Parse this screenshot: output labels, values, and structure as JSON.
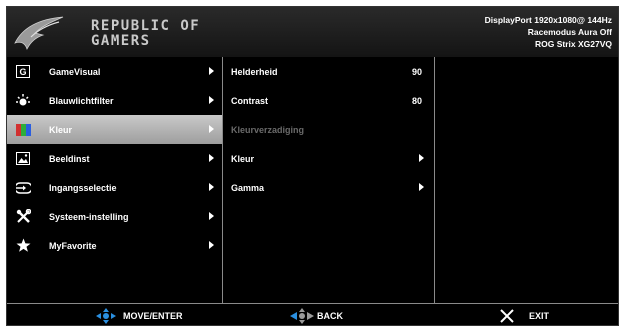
{
  "header": {
    "brand_line1": "REPUBLIC OF",
    "brand_line2": "GAMERS",
    "status_line1": "DisplayPort  1920x1080@  144Hz",
    "status_line2": "Racemodus Aura Off",
    "status_line3": "ROG Strix XG27VQ"
  },
  "menu": [
    {
      "label": "GameVisual",
      "icon": "gamevisual-icon"
    },
    {
      "label": "Blauwlichtfilter",
      "icon": "bluelight-icon"
    },
    {
      "label": "Kleur",
      "icon": "color-icon",
      "active": true
    },
    {
      "label": "Beeldinst",
      "icon": "image-icon"
    },
    {
      "label": "Ingangsselectie",
      "icon": "input-icon"
    },
    {
      "label": "Systeem-instelling",
      "icon": "tools-icon"
    },
    {
      "label": "MyFavorite",
      "icon": "star-icon"
    }
  ],
  "submenu": [
    {
      "label": "Helderheid",
      "value": "90"
    },
    {
      "label": "Contrast",
      "value": "80"
    },
    {
      "label": "Kleurverzadiging",
      "disabled": true
    },
    {
      "label": "Kleur",
      "has_arrow": true
    },
    {
      "label": "Gamma",
      "has_arrow": true
    }
  ],
  "footer": {
    "move_label": "MOVE/ENTER",
    "back_label": "BACK",
    "exit_label": "EXIT"
  },
  "colors": {
    "background": "#000000",
    "active_item": "#b5b5b5",
    "accent_blue": "#2a8fe0",
    "disabled_text": "#6a6a6a"
  }
}
